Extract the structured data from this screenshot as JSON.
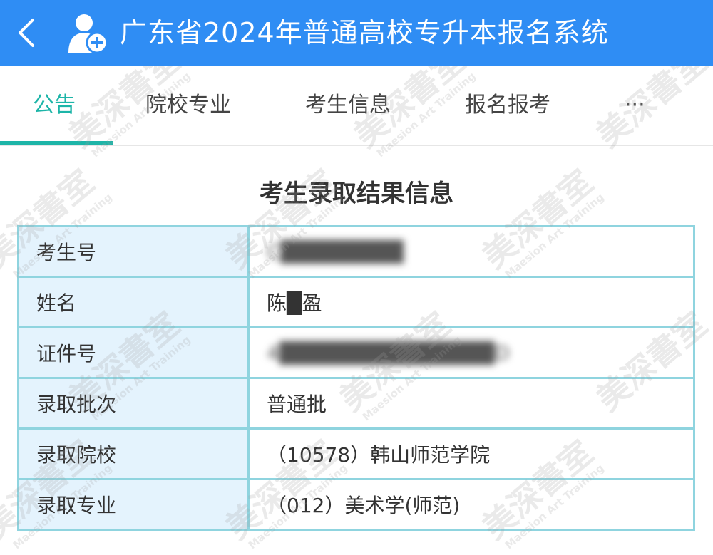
{
  "header": {
    "back_icon": "chevron-left-icon",
    "app_icon": "user-add-icon",
    "title": "广东省2024年普通高校专升本报名系统",
    "background": "#2f8df4"
  },
  "tabs": [
    {
      "label": "公告",
      "active": true
    },
    {
      "label": "院校专业",
      "active": false
    },
    {
      "label": "考生信息",
      "active": false
    },
    {
      "label": "报名报考",
      "active": false
    },
    {
      "label": "···",
      "active": false
    }
  ],
  "accent_color": "#1db5a8",
  "section": {
    "title": "考生录取结果信息"
  },
  "rows": [
    {
      "label": "考生号",
      "value": "C████████"
    },
    {
      "label": "姓名",
      "value": "陈█盈"
    },
    {
      "label": "证件号",
      "value": "4██████████████D"
    },
    {
      "label": "录取批次",
      "value": "普通批"
    },
    {
      "label": "录取院校",
      "value": "（10578）韩山师范学院"
    },
    {
      "label": "录取专业",
      "value": "（012）美术学(师范)"
    }
  ],
  "watermark": {
    "text_cn": "美深書室",
    "text_en": "Maesion Art Training"
  }
}
